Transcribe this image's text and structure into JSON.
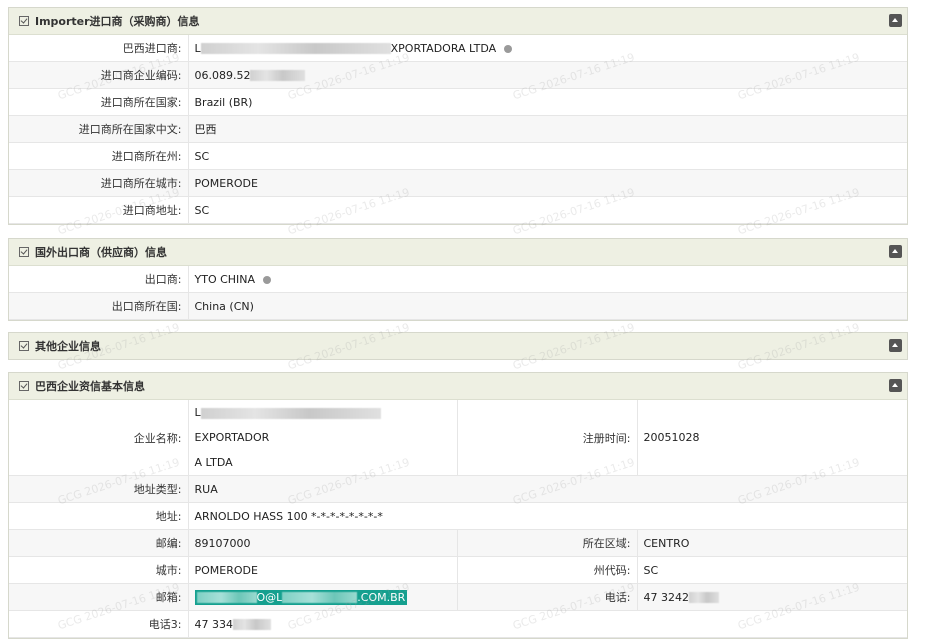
{
  "watermark": "GCG 2026-07-16 11:19",
  "importer": {
    "title": "Importer进口商（采购商）信息",
    "rows": [
      {
        "label": "巴西进口商:",
        "value_prefix": "L",
        "value_suffix": "XPORTADORA LTDA"
      },
      {
        "label": "进口商企业编码:",
        "value": "06.089.52"
      },
      {
        "label": "进口商所在国家:",
        "value": "Brazil (BR)"
      },
      {
        "label": "进口商所在国家中文:",
        "value": "巴西"
      },
      {
        "label": "进口商所在州:",
        "value": "SC"
      },
      {
        "label": "进口商所在城市:",
        "value": "POMERODE"
      },
      {
        "label": "进口商地址:",
        "value": "SC"
      }
    ]
  },
  "exporter": {
    "title": "国外出口商（供应商）信息",
    "rows": [
      {
        "label": "出口商:",
        "value": "YTO CHINA"
      },
      {
        "label": "出口商所在国:",
        "value": "China (CN)"
      }
    ]
  },
  "other": {
    "title": "其他企业信息"
  },
  "credit": {
    "title": "巴西企业资信基本信息",
    "company_label": "企业名称:",
    "company_line1_prefix": "L",
    "company_line1_suffix": "EXPORTADOR",
    "company_line2": "A LTDA",
    "reg_label": "注册时间:",
    "reg_value": "20051028",
    "addr_type_label": "地址类型:",
    "addr_type_value": "RUA",
    "addr_label": "地址:",
    "addr_value": "ARNOLDO HASS 100 *-*-*-*-*-*-*-*",
    "zip_label": "邮编:",
    "zip_value": "89107000",
    "region_label": "所在区域:",
    "region_value": "CENTRO",
    "city_label": "城市:",
    "city_value": "POMERODE",
    "state_code_label": "州代码:",
    "state_code_value": "SC",
    "email_label": "邮箱:",
    "email_mid": "O@L",
    "email_suffix": ".COM.BR",
    "phone_label": "电话:",
    "phone_value": "47 3242",
    "phone3_label": "电话3:",
    "phone3_value": "47 334"
  }
}
